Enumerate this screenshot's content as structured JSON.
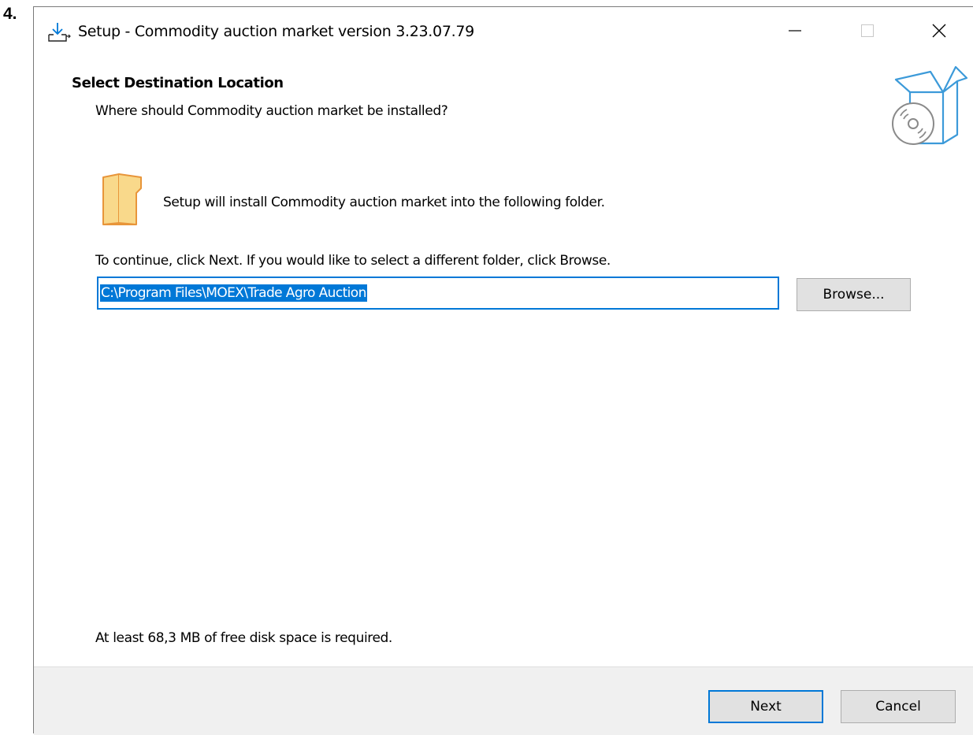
{
  "step_label": "4.",
  "window": {
    "title": "Setup - Commodity auction market  version 3.23.07.79",
    "icons": {
      "app": "setup-download-icon",
      "minimize": "minimize-icon",
      "maximize": "maximize-icon",
      "close": "close-icon"
    }
  },
  "header": {
    "title": "Select Destination Location",
    "subtitle": "Where should Commodity auction market  be installed?",
    "icon": "software-box-disc-icon"
  },
  "body": {
    "folder_icon": "folder-icon",
    "folder_text": "Setup will install Commodity auction market  into the following folder.",
    "instruction": "To continue, click Next. If you would like to select a different folder, click Browse.",
    "path_value": "C:\\Program Files\\MOEX\\Trade Agro Auction",
    "browse_label": "Browse...",
    "disk_space": "At least 68,3 MB of free disk space is required."
  },
  "footer": {
    "next_label": "Next",
    "cancel_label": "Cancel"
  },
  "colors": {
    "accent": "#0078d7",
    "footer_bg": "#f0f0f0",
    "button_bg": "#e1e1e1",
    "folder_fill": "#f9d98b",
    "folder_stroke": "#e8953a",
    "box_stroke": "#3c9ad9"
  }
}
